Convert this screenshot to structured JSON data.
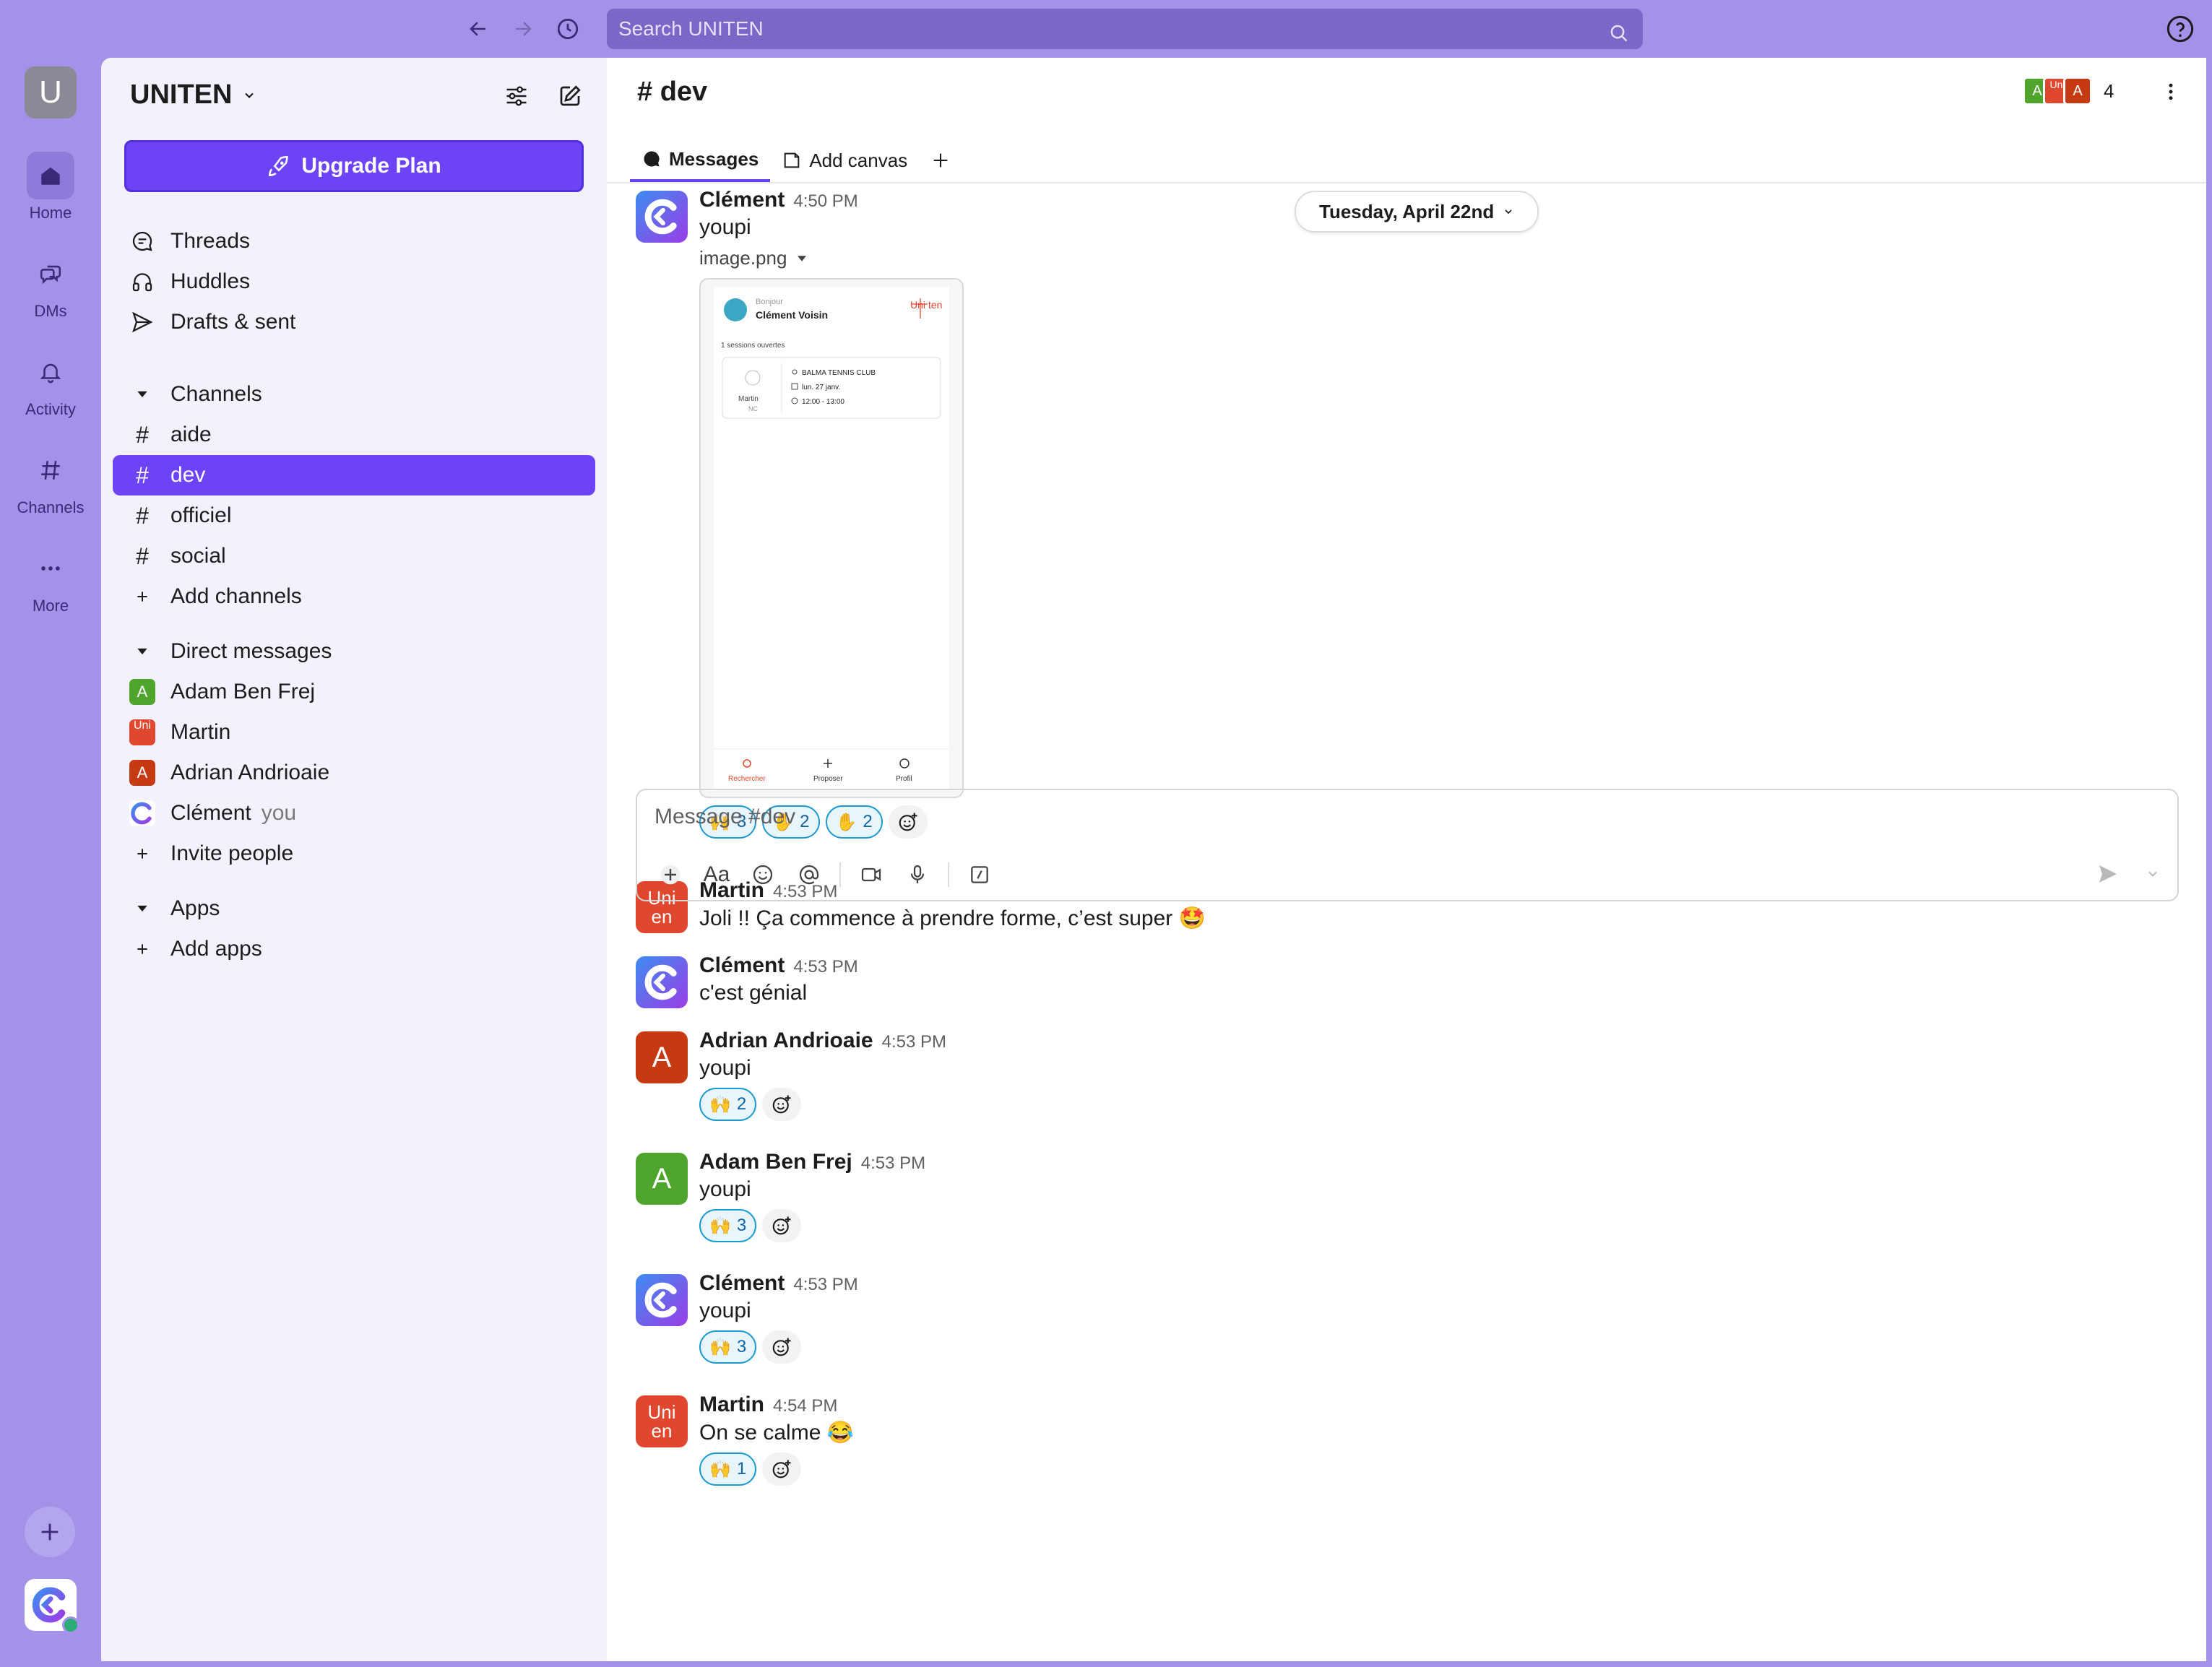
{
  "search": {
    "placeholder": "Search UNITEN"
  },
  "rail": {
    "workspace_initial": "U",
    "items": [
      {
        "label": "Home"
      },
      {
        "label": "DMs"
      },
      {
        "label": "Activity"
      },
      {
        "label": "Channels"
      },
      {
        "label": "More"
      }
    ]
  },
  "sidebar": {
    "workspace": "UNITEN",
    "upgrade": "Upgrade Plan",
    "top_items": [
      {
        "label": "Threads"
      },
      {
        "label": "Huddles"
      },
      {
        "label": "Drafts & sent"
      }
    ],
    "channels_header": "Channels",
    "channels": [
      {
        "label": "aide"
      },
      {
        "label": "dev"
      },
      {
        "label": "officiel"
      },
      {
        "label": "social"
      }
    ],
    "add_channels": "Add channels",
    "dm_header": "Direct messages",
    "dms": [
      {
        "label": "Adam Ben Frej",
        "initial": "A"
      },
      {
        "label": "Martin",
        "initial": "Uni"
      },
      {
        "label": "Adrian Andrioaie",
        "initial": "A"
      },
      {
        "label": "Clément",
        "suffix": "you"
      }
    ],
    "invite": "Invite people",
    "apps_header": "Apps",
    "add_apps": "Add apps"
  },
  "channel": {
    "title": "# dev",
    "member_count": "4",
    "tabs": [
      {
        "label": "Messages"
      },
      {
        "label": "Add canvas"
      }
    ],
    "date_divider": "Tuesday, April 22nd"
  },
  "messages": [
    {
      "author": "Clément",
      "time": "4:50 PM",
      "text": "youpi",
      "file": "image.png",
      "reactions": [
        {
          "emoji": "🙌",
          "count": "3"
        },
        {
          "emoji": "✋",
          "count": "2"
        },
        {
          "emoji": "✋",
          "count": "2"
        }
      ]
    },
    {
      "author": "Martin",
      "time": "4:53 PM",
      "text": "Joli !! Ça commence à prendre forme, c’est super 🤩"
    },
    {
      "author": "Clément",
      "time": "4:53 PM",
      "text": "c'est génial"
    },
    {
      "author": "Adrian Andrioaie",
      "time": "4:53 PM",
      "text": "youpi",
      "avatar": "A",
      "reactions": [
        {
          "emoji": "🙌",
          "count": "2"
        }
      ]
    },
    {
      "author": "Adam Ben Frej",
      "time": "4:53 PM",
      "text": "youpi",
      "avatar": "A",
      "reactions": [
        {
          "emoji": "🙌",
          "count": "3"
        }
      ]
    },
    {
      "author": "Clément",
      "time": "4:53 PM",
      "text": "youpi",
      "reactions": [
        {
          "emoji": "🙌",
          "count": "3"
        }
      ]
    },
    {
      "author": "Martin",
      "time": "4:54 PM",
      "text": "On se calme 😂",
      "reactions": [
        {
          "emoji": "🙌",
          "count": "1"
        }
      ]
    }
  ],
  "preview": {
    "greeting": "Bonjour",
    "name": "Clément Voisin",
    "sessions": "1 sessions ouvertes",
    "club": "BALMA TENNIS CLUB",
    "date": "lun. 27 janv.",
    "hours": "12:00 - 13:00",
    "player": "Martin",
    "level": "NC",
    "logo": "Uni ten",
    "nav": [
      "Rechercher",
      "Proposer",
      "Profil"
    ]
  },
  "composer": {
    "placeholder": "Message #dev",
    "format_label": "Aa"
  },
  "colors": {
    "accent": "#6c44f5",
    "rail": "#a491e8",
    "reaction": "#1d9bd1"
  }
}
